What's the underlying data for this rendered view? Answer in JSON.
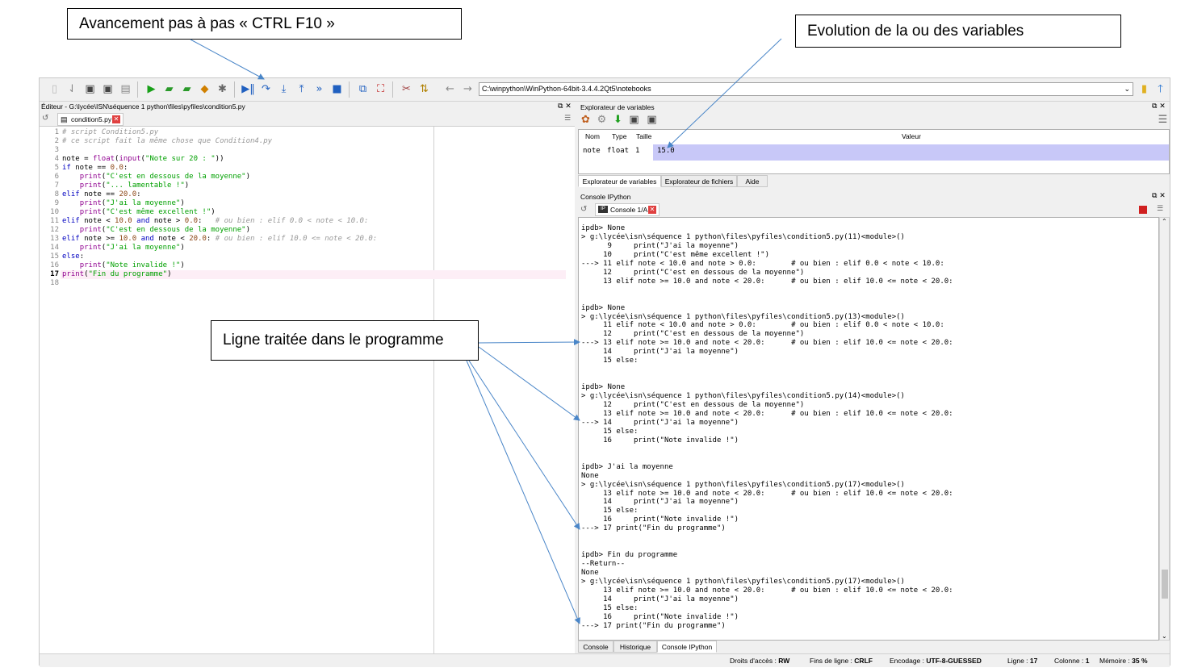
{
  "callouts": {
    "stepping": "Avancement pas à pas « CTRL F10 »",
    "variables": "Evolution de la ou des variables",
    "line": "Ligne traitée dans le programme"
  },
  "toolbar": {
    "path": "C:\\winpython\\WinPython-64bit-3.4.4.2Qt5\\notebooks",
    "icons": [
      "new-file-icon",
      "open-file-icon",
      "save-icon",
      "save-all-icon",
      "print-icon",
      "run-icon",
      "run-cell-icon",
      "run-cell-advance-icon",
      "run-selection-icon",
      "debug-icon",
      "debug-step-icon",
      "step-into-icon",
      "step-return-icon",
      "continue-icon",
      "stop-debug-icon",
      "maximize-pane-icon",
      "fullscreen-icon",
      "preferences-icon",
      "python-path-icon"
    ]
  },
  "editor": {
    "title": "Éditeur - G:\\lycée\\ISN\\séquence 1 python\\files\\pyfiles\\condition5.py",
    "tab": "condition5.py",
    "current_line": 17,
    "lines": [
      [
        {
          "c": "cm",
          "t": "# script Condition5.py"
        }
      ],
      [
        {
          "c": "cm",
          "t": "# ce script fait la même chose que Condition4.py"
        }
      ],
      [],
      [
        {
          "c": "",
          "t": "note = "
        },
        {
          "c": "bi",
          "t": "float"
        },
        {
          "c": "",
          "t": "("
        },
        {
          "c": "bi",
          "t": "input"
        },
        {
          "c": "",
          "t": "("
        },
        {
          "c": "str",
          "t": "\"Note sur 20 : \""
        },
        {
          "c": "",
          "t": "))"
        }
      ],
      [
        {
          "c": "kw",
          "t": "if"
        },
        {
          "c": "",
          "t": " note == "
        },
        {
          "c": "num",
          "t": "0.0"
        },
        {
          "c": "",
          "t": ":"
        }
      ],
      [
        {
          "c": "",
          "t": "    "
        },
        {
          "c": "bi",
          "t": "print"
        },
        {
          "c": "",
          "t": "("
        },
        {
          "c": "str",
          "t": "\"C'est en dessous de la moyenne\""
        },
        {
          "c": "",
          "t": ")"
        }
      ],
      [
        {
          "c": "",
          "t": "    "
        },
        {
          "c": "bi",
          "t": "print"
        },
        {
          "c": "",
          "t": "("
        },
        {
          "c": "str",
          "t": "\"... lamentable !\""
        },
        {
          "c": "",
          "t": ")"
        }
      ],
      [
        {
          "c": "kw",
          "t": "elif"
        },
        {
          "c": "",
          "t": " note == "
        },
        {
          "c": "num",
          "t": "20.0"
        },
        {
          "c": "",
          "t": ":"
        }
      ],
      [
        {
          "c": "",
          "t": "    "
        },
        {
          "c": "bi",
          "t": "print"
        },
        {
          "c": "",
          "t": "("
        },
        {
          "c": "str",
          "t": "\"J'ai la moyenne\""
        },
        {
          "c": "",
          "t": ")"
        }
      ],
      [
        {
          "c": "",
          "t": "    "
        },
        {
          "c": "bi",
          "t": "print"
        },
        {
          "c": "",
          "t": "("
        },
        {
          "c": "str",
          "t": "\"C'est même excellent !\""
        },
        {
          "c": "",
          "t": ")"
        }
      ],
      [
        {
          "c": "kw",
          "t": "elif"
        },
        {
          "c": "",
          "t": " note < "
        },
        {
          "c": "num",
          "t": "10.0"
        },
        {
          "c": "",
          "t": " "
        },
        {
          "c": "kw",
          "t": "and"
        },
        {
          "c": "",
          "t": " note > "
        },
        {
          "c": "num",
          "t": "0.0"
        },
        {
          "c": "",
          "t": ":   "
        },
        {
          "c": "cm",
          "t": "# ou bien : elif 0.0 < note < 10.0:"
        }
      ],
      [
        {
          "c": "",
          "t": "    "
        },
        {
          "c": "bi",
          "t": "print"
        },
        {
          "c": "",
          "t": "("
        },
        {
          "c": "str",
          "t": "\"C'est en dessous de la moyenne\""
        },
        {
          "c": "",
          "t": ")"
        }
      ],
      [
        {
          "c": "kw",
          "t": "elif"
        },
        {
          "c": "",
          "t": " note >= "
        },
        {
          "c": "num",
          "t": "10.0"
        },
        {
          "c": "",
          "t": " "
        },
        {
          "c": "kw",
          "t": "and"
        },
        {
          "c": "",
          "t": " note < "
        },
        {
          "c": "num",
          "t": "20.0"
        },
        {
          "c": "",
          "t": ": "
        },
        {
          "c": "cm",
          "t": "# ou bien : elif 10.0 <= note < 20.0:"
        }
      ],
      [
        {
          "c": "",
          "t": "    "
        },
        {
          "c": "bi",
          "t": "print"
        },
        {
          "c": "",
          "t": "("
        },
        {
          "c": "str",
          "t": "\"J'ai la moyenne\""
        },
        {
          "c": "",
          "t": ")"
        }
      ],
      [
        {
          "c": "kw",
          "t": "else"
        },
        {
          "c": "",
          "t": ":"
        }
      ],
      [
        {
          "c": "",
          "t": "    "
        },
        {
          "c": "bi",
          "t": "print"
        },
        {
          "c": "",
          "t": "("
        },
        {
          "c": "str",
          "t": "\"Note invalide !\""
        },
        {
          "c": "",
          "t": ")"
        }
      ],
      [
        {
          "c": "bi",
          "t": "print"
        },
        {
          "c": "",
          "t": "("
        },
        {
          "c": "str",
          "t": "\"Fin du programme\""
        },
        {
          "c": "",
          "t": ")"
        }
      ],
      []
    ]
  },
  "variable_explorer": {
    "title": "Explorateur de variables",
    "headers": [
      "Nom",
      "Type",
      "Taille",
      "Valeur"
    ],
    "row": [
      "note",
      "float",
      "1",
      "15.0"
    ],
    "tabs": [
      "Explorateur de variables",
      "Explorateur de fichiers",
      "Aide"
    ]
  },
  "console": {
    "title": "Console IPython",
    "tab": "Console 1/A",
    "lines": [
      "ipdb> None",
      "> g:\\lycée\\isn\\séquence 1 python\\files\\pyfiles\\condition5.py(11)<module>()",
      "      9     print(\"J'ai la moyenne\")",
      "     10     print(\"C'est même excellent !\")",
      "---> 11 elif note < 10.0 and note > 0.0:        # ou bien : elif 0.0 < note < 10.0:",
      "     12     print(\"C'est en dessous de la moyenne\")",
      "     13 elif note >= 10.0 and note < 20.0:      # ou bien : elif 10.0 <= note < 20.0:",
      "",
      "",
      "ipdb> None",
      "> g:\\lycée\\isn\\séquence 1 python\\files\\pyfiles\\condition5.py(13)<module>()",
      "     11 elif note < 10.0 and note > 0.0:        # ou bien : elif 0.0 < note < 10.0:",
      "     12     print(\"C'est en dessous de la moyenne\")",
      "---> 13 elif note >= 10.0 and note < 20.0:      # ou bien : elif 10.0 <= note < 20.0:",
      "     14     print(\"J'ai la moyenne\")",
      "     15 else:",
      "",
      "",
      "ipdb> None",
      "> g:\\lycée\\isn\\séquence 1 python\\files\\pyfiles\\condition5.py(14)<module>()",
      "     12     print(\"C'est en dessous de la moyenne\")",
      "     13 elif note >= 10.0 and note < 20.0:      # ou bien : elif 10.0 <= note < 20.0:",
      "---> 14     print(\"J'ai la moyenne\")",
      "     15 else:",
      "     16     print(\"Note invalide !\")",
      "",
      "",
      "ipdb> J'ai la moyenne",
      "None",
      "> g:\\lycée\\isn\\séquence 1 python\\files\\pyfiles\\condition5.py(17)<module>()",
      "     13 elif note >= 10.0 and note < 20.0:      # ou bien : elif 10.0 <= note < 20.0:",
      "     14     print(\"J'ai la moyenne\")",
      "     15 else:",
      "     16     print(\"Note invalide !\")",
      "---> 17 print(\"Fin du programme\")",
      "",
      "",
      "ipdb> Fin du programme",
      "--Return--",
      "None",
      "> g:\\lycée\\isn\\séquence 1 python\\files\\pyfiles\\condition5.py(17)<module>()",
      "     13 elif note >= 10.0 and note < 20.0:      # ou bien : elif 10.0 <= note < 20.0:",
      "     14     print(\"J'ai la moyenne\")",
      "     15 else:",
      "     16     print(\"Note invalide !\")",
      "---> 17 print(\"Fin du programme\")"
    ],
    "bottom_tabs": [
      "Console",
      "Historique",
      "Console IPython"
    ]
  },
  "status": {
    "access_label": "Droits d'accès :",
    "access_value": "RW",
    "eol_label": "Fins de ligne :",
    "eol_value": "CRLF",
    "enc_label": "Encodage :",
    "enc_value": "UTF-8-GUESSED",
    "line_label": "Ligne :",
    "line_value": "17",
    "col_label": "Colonne :",
    "col_value": "1",
    "mem_label": "Mémoire :",
    "mem_value": "35 %"
  },
  "colors": {
    "arrow": "#4a86c8",
    "selection": "#c8c8f8",
    "current_line": "#fdeef6"
  }
}
